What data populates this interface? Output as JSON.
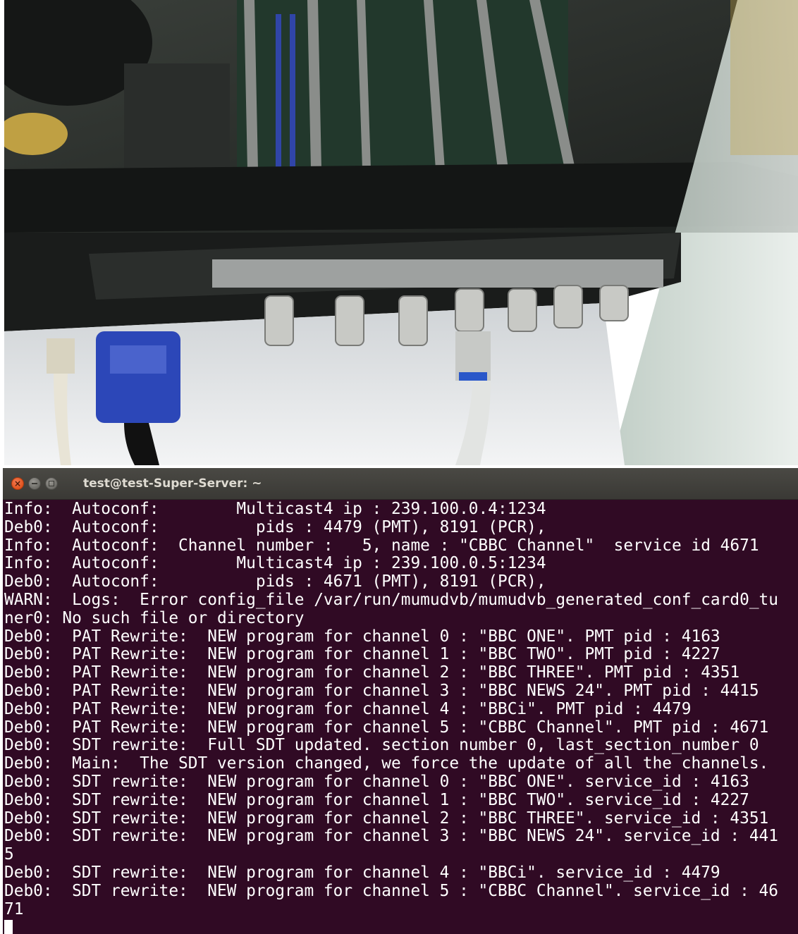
{
  "window": {
    "title": "test@test-Super-Server: ~",
    "close_glyph": "×"
  },
  "photo": {
    "icons": [
      "server-chassis-photo"
    ]
  },
  "terminal": {
    "lines": [
      "Info:  Autoconf:        Multicast4 ip : 239.100.0.4:1234",
      "Deb0:  Autoconf:          pids : 4479 (PMT), 8191 (PCR),",
      "Info:  Autoconf:  Channel number :   5, name : \"CBBC Channel\"  service id 4671",
      "Info:  Autoconf:        Multicast4 ip : 239.100.0.5:1234",
      "Deb0:  Autoconf:          pids : 4671 (PMT), 8191 (PCR),",
      "WARN:  Logs:  Error config_file /var/run/mumudvb/mumudvb_generated_conf_card0_tu",
      "ner0: No such file or directory",
      "Deb0:  PAT Rewrite:  NEW program for channel 0 : \"BBC ONE\". PMT pid : 4163",
      "Deb0:  PAT Rewrite:  NEW program for channel 1 : \"BBC TWO\". PMT pid : 4227",
      "Deb0:  PAT Rewrite:  NEW program for channel 2 : \"BBC THREE\". PMT pid : 4351",
      "Deb0:  PAT Rewrite:  NEW program for channel 3 : \"BBC NEWS 24\". PMT pid : 4415",
      "Deb0:  PAT Rewrite:  NEW program for channel 4 : \"BBCi\". PMT pid : 4479",
      "Deb0:  PAT Rewrite:  NEW program for channel 5 : \"CBBC Channel\". PMT pid : 4671",
      "Deb0:  SDT rewrite:  Full SDT updated. section number 0, last_section_number 0",
      "Deb0:  Main:  The SDT version changed, we force the update of all the channels.",
      "Deb0:  SDT rewrite:  NEW program for channel 0 : \"BBC ONE\". service_id : 4163",
      "Deb0:  SDT rewrite:  NEW program for channel 1 : \"BBC TWO\". service_id : 4227",
      "Deb0:  SDT rewrite:  NEW program for channel 2 : \"BBC THREE\". service_id : 4351",
      "Deb0:  SDT rewrite:  NEW program for channel 3 : \"BBC NEWS 24\". service_id : 441",
      "5",
      "Deb0:  SDT rewrite:  NEW program for channel 4 : \"BBCi\". service_id : 4479",
      "Deb0:  SDT rewrite:  NEW program for channel 5 : \"CBBC Channel\". service_id : 46",
      "71"
    ]
  }
}
